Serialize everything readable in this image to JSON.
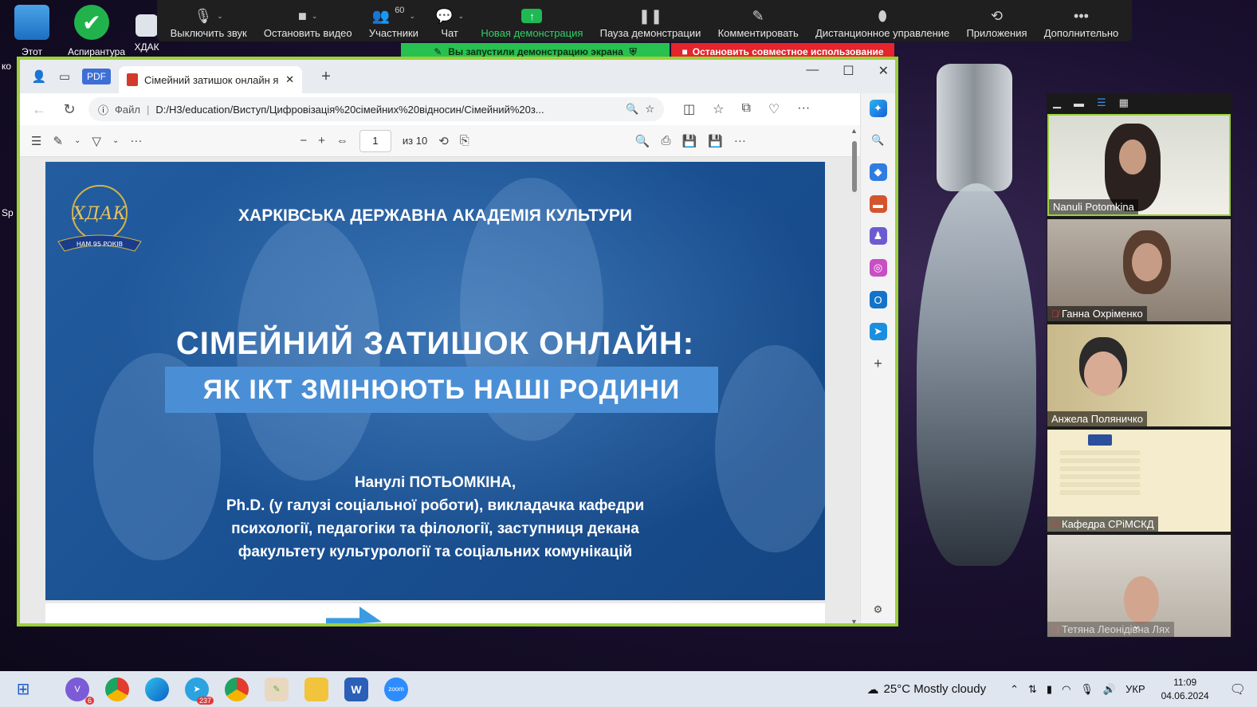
{
  "desktop": {
    "icons": [
      {
        "label": "Этот"
      },
      {
        "label": "Аспирантура"
      },
      {
        "label": "ХДАК"
      }
    ],
    "left_fragments": [
      "ко",
      "Sp"
    ]
  },
  "zoom_toolbar": {
    "items": [
      {
        "label": "Выключить звук",
        "icon": "microphone-icon"
      },
      {
        "label": "Остановить видео",
        "icon": "video-camera-icon"
      },
      {
        "label": "Участники",
        "icon": "participants-icon",
        "count": "60"
      },
      {
        "label": "Чат",
        "icon": "chat-icon"
      },
      {
        "label": "Новая демонстрация",
        "icon": "share-screen-icon"
      },
      {
        "label": "Пауза демонстрации",
        "icon": "pause-icon"
      },
      {
        "label": "Комментировать",
        "icon": "pencil-icon"
      },
      {
        "label": "Дистанционное управление",
        "icon": "mouse-icon"
      },
      {
        "label": "Приложения",
        "icon": "apps-icon"
      },
      {
        "label": "Дополнительно",
        "icon": "more-icon"
      }
    ],
    "share_status": "Вы запустили демонстрацию экрана",
    "stop_share": "Остановить совместное использование"
  },
  "browser": {
    "pdf_badge": "PDF",
    "tab_title": "Сімейний затишок онлайн як ІК",
    "url_scheme": "Файл",
    "url": "D:/H3/education/Виступ/Цифровізація%20сімейних%20відносин/Сімейний%20з...",
    "page_current": "1",
    "page_total": "из 10"
  },
  "slide": {
    "academy": "ХАРКІВСЬКА ДЕРЖАВНА АКАДЕМІЯ КУЛЬТУРИ",
    "logo_ribbon": "НАМ 95 РОКІВ",
    "title": "СІМЕЙНИЙ ЗАТИШОК ОНЛАЙН:",
    "subtitle": "ЯК ІКТ ЗМІНЮЮТЬ НАШІ РОДИНИ",
    "author_lines": [
      "Нанулі ПОТЬОМКІНА,",
      "Ph.D. (у галузі соціальної роботи), викладачка кафедри",
      "психології, педагогіки та філології, заступниця декана",
      "факультету культурології та соціальних комунікацій"
    ]
  },
  "gallery": {
    "participants": [
      {
        "name": "Nanuli Potomkina",
        "muted": false
      },
      {
        "name": "Ганна Охріменко",
        "muted": true
      },
      {
        "name": "Анжела Поляничко",
        "muted": false
      },
      {
        "name": "Кафедра СРіМСКД",
        "muted": true
      },
      {
        "name": "Тетяна Леонідівна Лях",
        "muted": true
      }
    ]
  },
  "taskbar": {
    "badges": {
      "viber": "6",
      "telegram": "237"
    },
    "weather": "25°C  Mostly cloudy",
    "lang": "УКР",
    "time": "11:09",
    "date": "04.06.2024"
  }
}
